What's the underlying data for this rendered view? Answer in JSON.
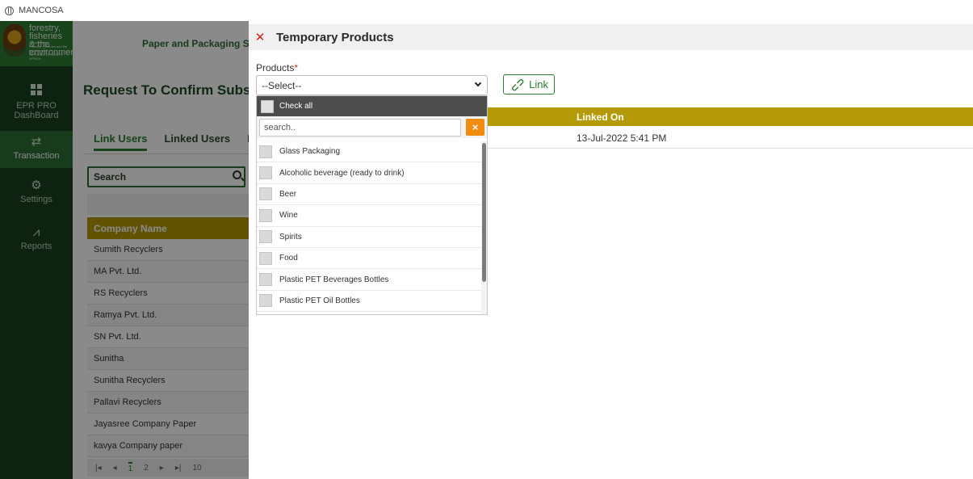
{
  "window": {
    "title": "MANCOSA"
  },
  "sidebar": {
    "logo": {
      "line1": "forestry, fisheries",
      "line2": "& the environment",
      "small1": "Department:",
      "small2": "Forestry, Fisheries and the Environment",
      "small3": "REPUBLIC OF SOUTH AFRICA"
    },
    "items": [
      {
        "label1": "EPR PRO",
        "label2": "DashBoard",
        "icon": "dashboard-grid-icon"
      },
      {
        "label1": "Transaction",
        "icon": "arrows-exchange-icon"
      },
      {
        "label1": "Settings",
        "icon": "gears-icon"
      },
      {
        "label1": "Reports",
        "icon": "chart-line-icon"
      }
    ]
  },
  "main": {
    "header_title": "Paper and Packaging Sec",
    "page_title": "Request To Confirm Subscr",
    "tabs": [
      "Link Users",
      "Linked Users",
      "P"
    ],
    "search_label": "Search",
    "table_header": "Company Name",
    "rows": [
      "Sumith Recyclers",
      "MA Pvt. Ltd.",
      "RS Recyclers",
      "Ramya Pvt. Ltd.",
      "SN Pvt. Ltd.",
      "Sunitha",
      "Sunitha Recyclers",
      "Pallavi Recyclers",
      "Jayasree Company Paper",
      "kavya Company paper"
    ],
    "pager": [
      "1",
      "2",
      "10"
    ]
  },
  "panel": {
    "title": "Temporary Products",
    "products_label": "Products",
    "required_mark": "*",
    "select_value": "--Select--",
    "link_button": "Link",
    "linked_on_header": "Linked On",
    "linked_on_value": "13-Jul-2022 5:41 PM",
    "dropdown": {
      "check_all": "Check all",
      "search_placeholder": "search..",
      "clear_label": "×",
      "items": [
        "Glass Packaging",
        "Alcoholic beverage (ready to drink)",
        "Beer",
        "Wine",
        "Spirits",
        "Food",
        "Plastic PET Beverages Bottles",
        "Plastic PET Oil Bottles"
      ]
    }
  },
  "colors": {
    "accent_green": "#2e7d32",
    "table_header_gold": "#b59a07",
    "close_red": "#d12020",
    "clear_orange": "#f28c0f"
  }
}
